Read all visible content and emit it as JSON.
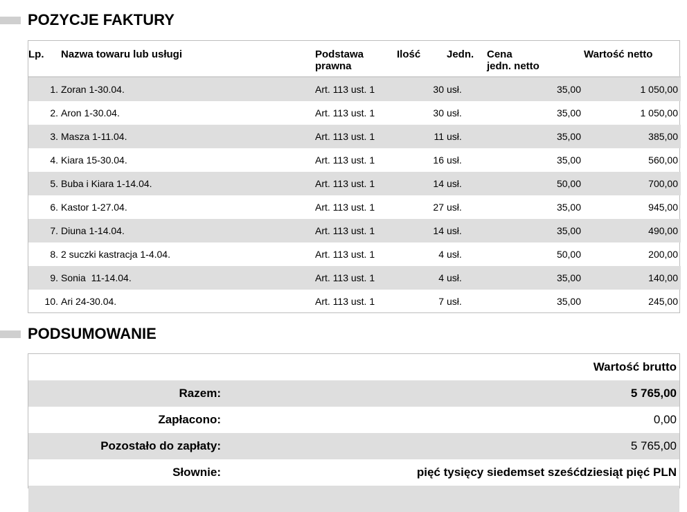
{
  "sections": {
    "items_title": "POZYCJE FAKTURY",
    "summary_title": "PODSUMOWANIE"
  },
  "items_table": {
    "headers": {
      "lp": "Lp.",
      "name": "Nazwa towaru lub usługi",
      "base_line1": "Podstawa",
      "base_line2": "prawna",
      "qty": "Ilość",
      "unit": "Jedn.",
      "price_line1": "Cena",
      "price_line2": "jedn. netto",
      "value": "Wartość netto"
    },
    "rows": [
      {
        "lp": "1.",
        "name": "Zoran 1-30.04.",
        "base": "Art. 113 ust. 1",
        "qty": "30",
        "unit": "usł.",
        "price": "35,00",
        "value": "1 050,00"
      },
      {
        "lp": "2.",
        "name": "Aron 1-30.04.",
        "base": "Art. 113 ust. 1",
        "qty": "30",
        "unit": "usł.",
        "price": "35,00",
        "value": "1 050,00"
      },
      {
        "lp": "3.",
        "name": "Masza 1-11.04.",
        "base": "Art. 113 ust. 1",
        "qty": "11",
        "unit": "usł.",
        "price": "35,00",
        "value": "385,00"
      },
      {
        "lp": "4.",
        "name": "Kiara 15-30.04.",
        "base": "Art. 113 ust. 1",
        "qty": "16",
        "unit": "usł.",
        "price": "35,00",
        "value": "560,00"
      },
      {
        "lp": "5.",
        "name": "Buba i Kiara 1-14.04.",
        "base": "Art. 113 ust. 1",
        "qty": "14",
        "unit": "usł.",
        "price": "50,00",
        "value": "700,00"
      },
      {
        "lp": "6.",
        "name": "Kastor 1-27.04.",
        "base": "Art. 113 ust. 1",
        "qty": "27",
        "unit": "usł.",
        "price": "35,00",
        "value": "945,00"
      },
      {
        "lp": "7.",
        "name": "Diuna 1-14.04.",
        "base": "Art. 113 ust. 1",
        "qty": "14",
        "unit": "usł.",
        "price": "35,00",
        "value": "490,00"
      },
      {
        "lp": "8.",
        "name": "2 suczki kastracja 1-4.04.",
        "base": "Art. 113 ust. 1",
        "qty": "4",
        "unit": "usł.",
        "price": "50,00",
        "value": "200,00"
      },
      {
        "lp": "9.",
        "name": "Sonia  11-14.04.",
        "base": "Art. 113 ust. 1",
        "qty": "4",
        "unit": "usł.",
        "price": "35,00",
        "value": "140,00"
      },
      {
        "lp": "10.",
        "name": "Ari 24-30.04.",
        "base": "Art. 113 ust. 1",
        "qty": "7",
        "unit": "usł.",
        "price": "35,00",
        "value": "245,00"
      }
    ]
  },
  "summary": {
    "gross_header": "Wartość brutto",
    "total_label": "Razem:",
    "total_value": "5 765,00",
    "paid_label": "Zapłacono:",
    "paid_value": "0,00",
    "remaining_label": "Pozostało do zapłaty:",
    "remaining_value": "5 765,00",
    "words_label": "Słownie:",
    "words_value": "pięć tysięcy siedemset sześćdziesiąt pięć PLN"
  }
}
